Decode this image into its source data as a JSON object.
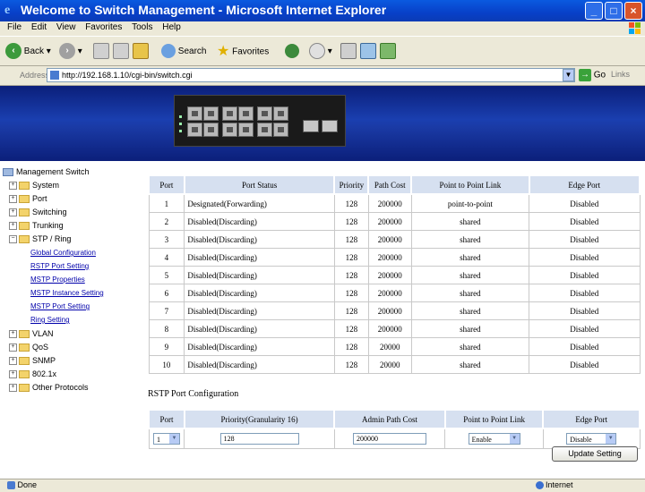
{
  "window": {
    "title": "Welcome to Switch Management - Microsoft Internet Explorer",
    "icon": "ie-icon"
  },
  "menu": [
    "File",
    "Edit",
    "View",
    "Favorites",
    "Tools",
    "Help"
  ],
  "toolbar": {
    "back_label": "Back",
    "search_label": "Search",
    "favorites_label": "Favorites"
  },
  "address": {
    "label": "Address",
    "url": "http://192.168.1.10/cgi-bin/switch.cgi",
    "go_label": "Go",
    "links_label": "Links"
  },
  "sidebar": {
    "root": "Management Switch",
    "items": [
      {
        "label": "System"
      },
      {
        "label": "Port"
      },
      {
        "label": "Switching"
      },
      {
        "label": "Trunking"
      },
      {
        "label": "STP / Ring"
      },
      {
        "label": "VLAN"
      },
      {
        "label": "QoS"
      },
      {
        "label": "SNMP"
      },
      {
        "label": "802.1x"
      },
      {
        "label": "Other Protocols"
      }
    ],
    "stp_subitems": [
      "Global Configuration",
      "RSTP Port Setting",
      "MSTP Properties",
      "MSTP Instance Setting",
      "MSTP Port Setting",
      "Ring Setting"
    ]
  },
  "status_table": {
    "headers": [
      "Port",
      "Port Status",
      "Priority",
      "Path Cost",
      "Point to Point Link",
      "Edge Port"
    ],
    "rows": [
      [
        "1",
        "Designated(Forwarding)",
        "128",
        "200000",
        "point-to-point",
        "Disabled"
      ],
      [
        "2",
        "Disabled(Discarding)",
        "128",
        "200000",
        "shared",
        "Disabled"
      ],
      [
        "3",
        "Disabled(Discarding)",
        "128",
        "200000",
        "shared",
        "Disabled"
      ],
      [
        "4",
        "Disabled(Discarding)",
        "128",
        "200000",
        "shared",
        "Disabled"
      ],
      [
        "5",
        "Disabled(Discarding)",
        "128",
        "200000",
        "shared",
        "Disabled"
      ],
      [
        "6",
        "Disabled(Discarding)",
        "128",
        "200000",
        "shared",
        "Disabled"
      ],
      [
        "7",
        "Disabled(Discarding)",
        "128",
        "200000",
        "shared",
        "Disabled"
      ],
      [
        "8",
        "Disabled(Discarding)",
        "128",
        "200000",
        "shared",
        "Disabled"
      ],
      [
        "9",
        "Disabled(Discarding)",
        "128",
        "20000",
        "shared",
        "Disabled"
      ],
      [
        "10",
        "Disabled(Discarding)",
        "128",
        "20000",
        "shared",
        "Disabled"
      ]
    ]
  },
  "config": {
    "title": "RSTP Port Configuration",
    "headers": [
      "Port",
      "Priority(Granularity 16)",
      "Admin Path Cost",
      "Point to Point Link",
      "Edge Port"
    ],
    "port_value": "1",
    "priority_value": "128",
    "path_cost_value": "200000",
    "p2p_value": "Enable",
    "edge_value": "Disable",
    "update_label": "Update Setting"
  },
  "status_bar": {
    "left": "Done",
    "zone": "Internet"
  }
}
